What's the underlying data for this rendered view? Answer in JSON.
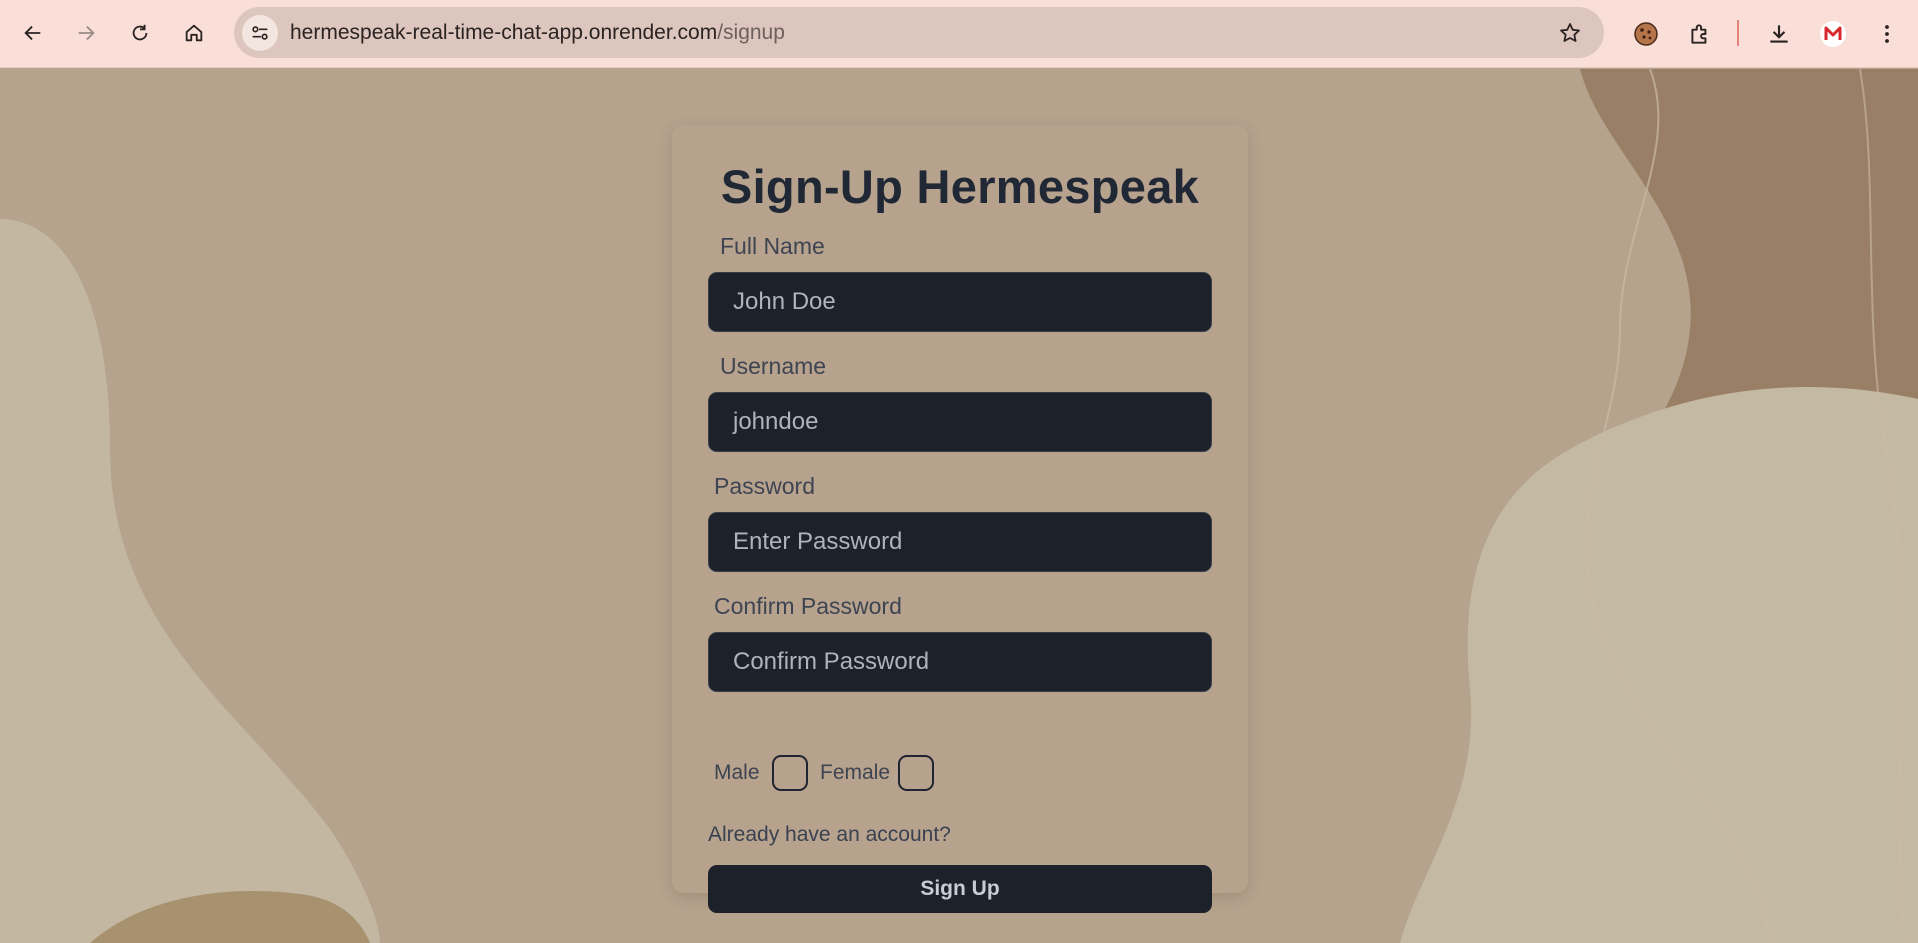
{
  "browser": {
    "url_host": "hermespeak-real-time-chat-app.onrender.com",
    "url_path": "/signup",
    "icons": [
      "back-icon",
      "forward-icon",
      "reload-icon",
      "home-icon",
      "site-info-icon",
      "bookmark-star-icon",
      "cookie-extension-icon",
      "extensions-puzzle-icon",
      "download-icon",
      "profile-m-icon",
      "menu-kebab-icon"
    ]
  },
  "form": {
    "title": "Sign-Up Hermespeak",
    "full_name_label": "Full Name",
    "full_name_placeholder": "John Doe",
    "username_label": "Username",
    "username_placeholder": "johndoe",
    "password_label": "Password",
    "password_placeholder": "Enter Password",
    "confirm_label": "Confirm Password",
    "confirm_placeholder": "Confirm Password",
    "male_label": "Male",
    "female_label": "Female",
    "login_link": "Already have an account?",
    "submit_label": "Sign Up"
  },
  "colors": {
    "chrome_bg": "#f9dfd7",
    "page_bg": "#b5a38e",
    "input_bg": "#1c212a",
    "title_color": "#202836"
  }
}
